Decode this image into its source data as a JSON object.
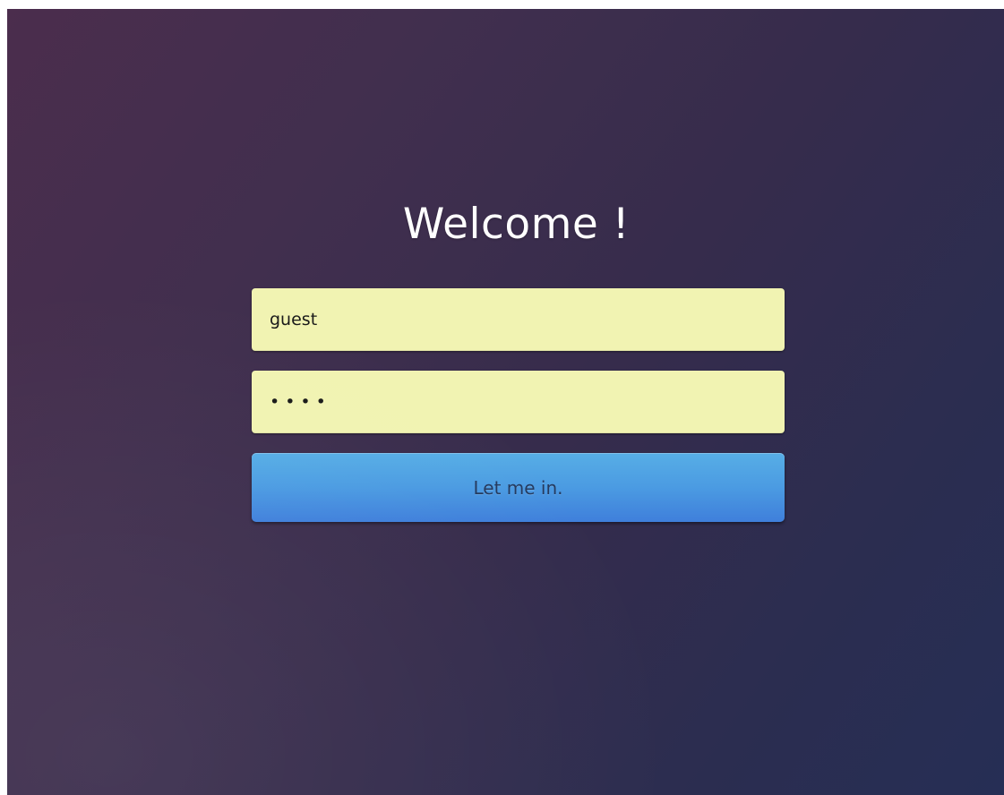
{
  "login": {
    "title": "Welcome !",
    "username_value": "guest",
    "password_value": "••••",
    "submit_label": "Let me in."
  },
  "colors": {
    "background_start": "#4b2d4d",
    "background_end": "#262e55",
    "input_background": "#f1f3b2",
    "button_top": "#57aee6",
    "button_bottom": "#3f7fdb",
    "button_text": "#253a5e",
    "title_text": "#ffffff"
  }
}
